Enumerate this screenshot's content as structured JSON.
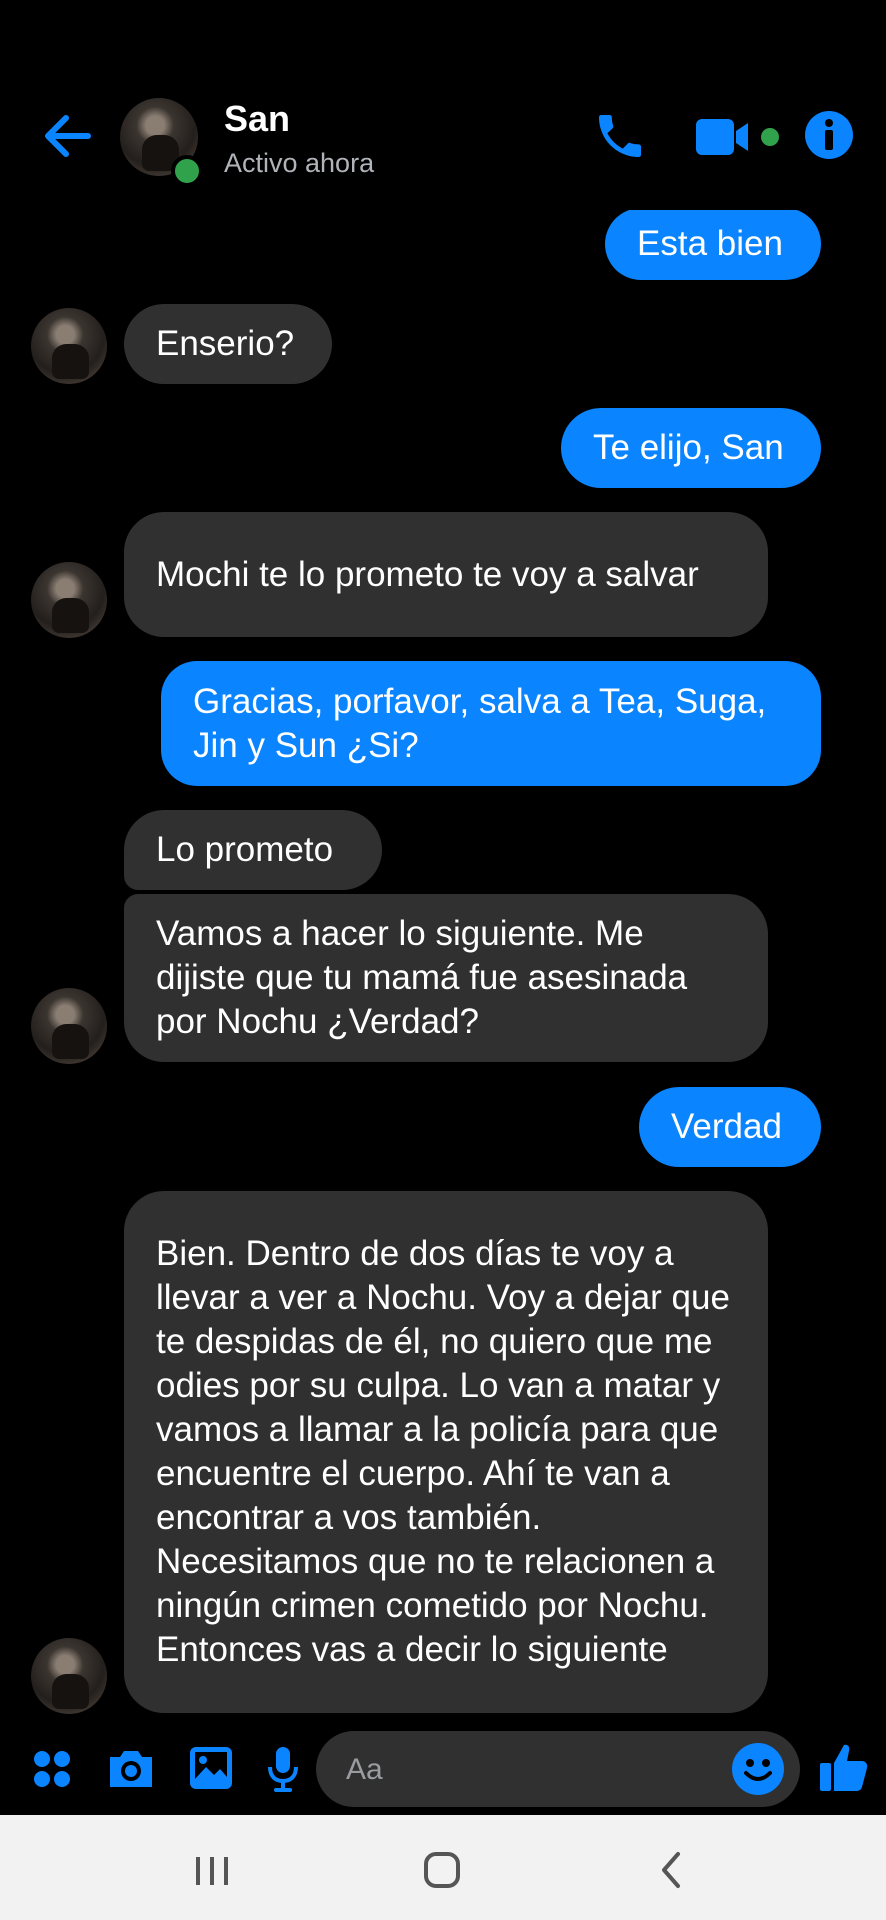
{
  "header": {
    "contact_name": "San",
    "status": "Activo ahora"
  },
  "colors": {
    "accent": "#0a84ff",
    "incoming_bubble": "#303030",
    "online": "#31a24c"
  },
  "messages": [
    {
      "dir": "out",
      "text": "Esta bien"
    },
    {
      "dir": "in",
      "text": "Enserio?",
      "avatar": true
    },
    {
      "dir": "out",
      "text": "Te elijo, San"
    },
    {
      "dir": "in",
      "text": "Mochi te lo prometo te voy a salvar",
      "avatar": true
    },
    {
      "dir": "out",
      "text": "Gracias, porfavor, salva a Tea, Suga, Jin y Sun ¿Si?"
    },
    {
      "dir": "in",
      "text": "Lo prometo",
      "avatar": false
    },
    {
      "dir": "in",
      "text": "Vamos a hacer lo siguiente. Me dijiste que tu mamá fue asesinada por Nochu ¿Verdad?",
      "avatar": true
    },
    {
      "dir": "out",
      "text": "Verdad"
    },
    {
      "dir": "in",
      "text": "Bien. Dentro de dos días te voy a llevar a ver a Nochu. Voy a dejar que te despidas de él, no quiero que me odies por su culpa. Lo van a matar y vamos a llamar a la policía para que encuentre el cuerpo. Ahí te van a encontrar a vos también. Necesitamos que no te relacionen a ningún crimen cometido por Nochu. Entonces vas a decir lo siguiente",
      "avatar": true
    }
  ],
  "composer": {
    "placeholder": "Aa",
    "icons": [
      "apps-icon",
      "camera-icon",
      "gallery-icon",
      "microphone-icon",
      "emoji-icon",
      "thumbs-up-icon"
    ]
  },
  "navbar": {
    "icons": [
      "recent-apps-icon",
      "home-icon",
      "back-icon"
    ]
  }
}
